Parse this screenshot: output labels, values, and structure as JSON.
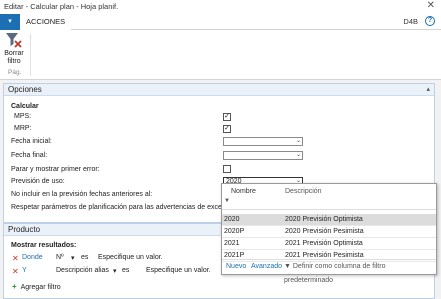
{
  "window": {
    "title": "Editar - Calcular plan - Hoja planif.",
    "close_glyph": "✕"
  },
  "tabs": {
    "menu_glyph": "▾",
    "acciones": "ACCIONES",
    "company": "D4B",
    "help_glyph": "?"
  },
  "ribbon": {
    "borrar_filtro": "Borrar filtro",
    "group_label": "Pág."
  },
  "opciones": {
    "header": "Opciones",
    "calcular_label": "Calcular",
    "mps_label": "MPS:",
    "mps_checked": true,
    "mrp_label": "MRP:",
    "mrp_checked": true,
    "fecha_inicial_label": "Fecha inicial:",
    "fecha_inicial_value": "",
    "fecha_final_label": "Fecha final:",
    "fecha_final_value": "",
    "parar_label": "Parar y mostrar primer error:",
    "parar_checked": false,
    "prevision_label": "Previsión de uso:",
    "prevision_value": "2020",
    "no_incluir_label": "No incluir en la previsión fechas anteriores al:",
    "respetar_label": "Respetar parámetros de planificación para las advertencias de excepción:"
  },
  "dropdown": {
    "col_nombre": "Nombre",
    "col_descripcion": "Descripción",
    "rows": [
      {
        "nombre": "2020",
        "descripcion": "2020 Previsión Optimista",
        "selected": true
      },
      {
        "nombre": "2020P",
        "descripcion": "2020 Previsión Pesimista",
        "selected": false
      },
      {
        "nombre": "2021",
        "descripcion": "2021 Previsión Optimista",
        "selected": false
      },
      {
        "nombre": "2021P",
        "descripcion": "2021 Previsión Pesimista",
        "selected": false
      }
    ],
    "nuevo": "Nuevo",
    "avanzado": "Avanzado",
    "definir": "Definir como columna de filtro predeterminado"
  },
  "producto": {
    "header": "Producto",
    "mostrar_resultados": "Mostrar resultados:",
    "filters": [
      {
        "connector": "Donde",
        "field": "Nº",
        "operator": "es",
        "value_placeholder": "Especifique un valor."
      },
      {
        "connector": "Y",
        "field": "Descripción alias",
        "operator": "es",
        "value_placeholder": "Especifique un valor."
      }
    ],
    "agregar_filtro": "Agregar filtro"
  }
}
